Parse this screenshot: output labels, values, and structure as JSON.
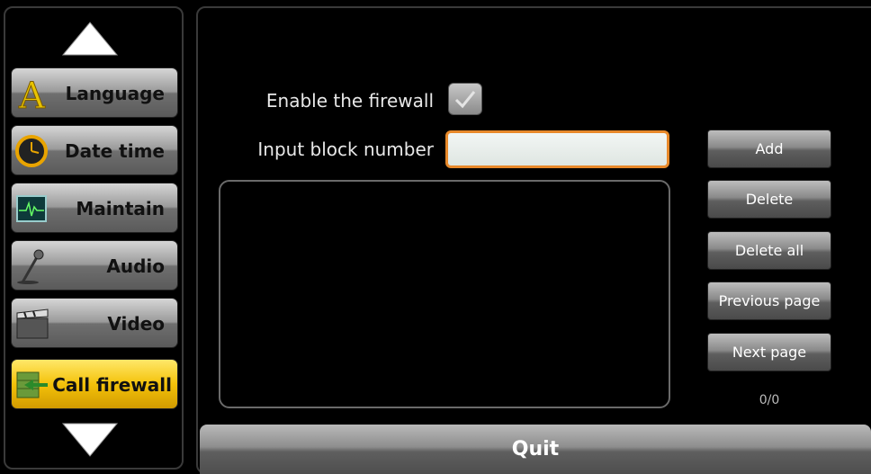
{
  "sidebar": {
    "items": [
      {
        "label": "Language",
        "icon": "language-letter-icon"
      },
      {
        "label": "Date time",
        "icon": "clock-icon"
      },
      {
        "label": "Maintain",
        "icon": "monitor-pulse-icon"
      },
      {
        "label": "Audio",
        "icon": "microphone-icon"
      },
      {
        "label": "Video",
        "icon": "clapperboard-icon"
      },
      {
        "label": "Call firewall",
        "icon": "firewall-icon",
        "active": true
      }
    ]
  },
  "firewall": {
    "enable_label": "Enable the firewall",
    "enable_checked": true,
    "block_label": "Input block number",
    "block_value": "",
    "add_label": "Add",
    "delete_label": "Delete",
    "delete_all_label": "Delete all",
    "previous_label": "Previous page",
    "next_label": "Next page",
    "page_count": "0/0",
    "quit_label": "Quit"
  },
  "colors": {
    "active_item": "#f4c20a",
    "input_border": "#e8892a"
  }
}
